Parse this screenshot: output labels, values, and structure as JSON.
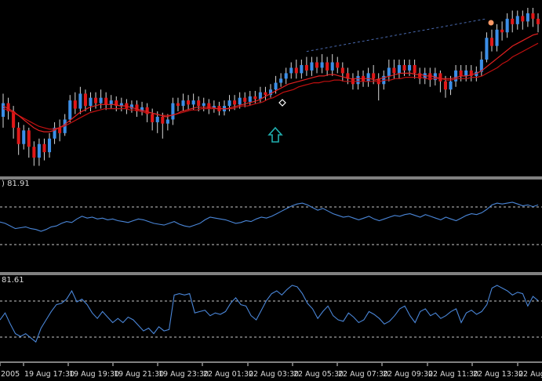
{
  "colors": {
    "background": "#000000",
    "bull_candle": "#3c8fe8",
    "bear_candle": "#e01818",
    "wick": "#d8d8d8",
    "ma_fast": "#e02020",
    "ma_slow": "#c01010",
    "indicator_line": "#4a86d8",
    "level_line": "#c8c8c8",
    "separator": "#ffffff",
    "arrow": "#20b0b0",
    "marker_up": "#ff9966",
    "marker_diamond": "#ffffff",
    "trendline": "#4a6ab0"
  },
  "panels": {
    "indicator1": {
      "label": ") 81.91"
    },
    "indicator2": {
      "label": "81.61"
    }
  },
  "chart_data": [
    {
      "type": "candlestick",
      "title": "",
      "legend": "none",
      "y_axis": "not shown",
      "series": [
        {
          "name": "",
          "values": []
        }
      ],
      "candles_rel": [
        {
          "o": 0.38,
          "c": 0.48,
          "h": 0.55,
          "l": 0.3
        },
        {
          "o": 0.48,
          "c": 0.42,
          "h": 0.52,
          "l": 0.36
        },
        {
          "o": 0.42,
          "c": 0.3,
          "h": 0.46,
          "l": 0.22
        },
        {
          "o": 0.3,
          "c": 0.18,
          "h": 0.34,
          "l": 0.1
        },
        {
          "o": 0.18,
          "c": 0.28,
          "h": 0.32,
          "l": 0.14
        },
        {
          "o": 0.28,
          "c": 0.16,
          "h": 0.3,
          "l": 0.08
        },
        {
          "o": 0.16,
          "c": 0.08,
          "h": 0.2,
          "l": 0.02
        },
        {
          "o": 0.08,
          "c": 0.18,
          "h": 0.22,
          "l": 0.02
        },
        {
          "o": 0.18,
          "c": 0.12,
          "h": 0.22,
          "l": 0.06
        },
        {
          "o": 0.12,
          "c": 0.22,
          "h": 0.26,
          "l": 0.08
        },
        {
          "o": 0.22,
          "c": 0.3,
          "h": 0.34,
          "l": 0.18
        },
        {
          "o": 0.3,
          "c": 0.26,
          "h": 0.36,
          "l": 0.2
        },
        {
          "o": 0.26,
          "c": 0.36,
          "h": 0.4,
          "l": 0.24
        },
        {
          "o": 0.36,
          "c": 0.5,
          "h": 0.54,
          "l": 0.34
        },
        {
          "o": 0.5,
          "c": 0.44,
          "h": 0.56,
          "l": 0.4
        },
        {
          "o": 0.44,
          "c": 0.55,
          "h": 0.6,
          "l": 0.4
        },
        {
          "o": 0.55,
          "c": 0.46,
          "h": 0.58,
          "l": 0.42
        },
        {
          "o": 0.46,
          "c": 0.52,
          "h": 0.56,
          "l": 0.42
        },
        {
          "o": 0.52,
          "c": 0.48,
          "h": 0.56,
          "l": 0.44
        },
        {
          "o": 0.48,
          "c": 0.52,
          "h": 0.58,
          "l": 0.44
        },
        {
          "o": 0.52,
          "c": 0.47,
          "h": 0.56,
          "l": 0.43
        },
        {
          "o": 0.47,
          "c": 0.5,
          "h": 0.54,
          "l": 0.44
        },
        {
          "o": 0.5,
          "c": 0.46,
          "h": 0.53,
          "l": 0.42
        },
        {
          "o": 0.46,
          "c": 0.48,
          "h": 0.52,
          "l": 0.42
        },
        {
          "o": 0.48,
          "c": 0.44,
          "h": 0.51,
          "l": 0.4
        },
        {
          "o": 0.44,
          "c": 0.47,
          "h": 0.5,
          "l": 0.41
        },
        {
          "o": 0.47,
          "c": 0.42,
          "h": 0.5,
          "l": 0.38
        },
        {
          "o": 0.42,
          "c": 0.45,
          "h": 0.49,
          "l": 0.39
        },
        {
          "o": 0.45,
          "c": 0.4,
          "h": 0.48,
          "l": 0.34
        },
        {
          "o": 0.4,
          "c": 0.34,
          "h": 0.44,
          "l": 0.28
        },
        {
          "o": 0.34,
          "c": 0.38,
          "h": 0.42,
          "l": 0.26
        },
        {
          "o": 0.38,
          "c": 0.33,
          "h": 0.41,
          "l": 0.22
        },
        {
          "o": 0.33,
          "c": 0.36,
          "h": 0.4,
          "l": 0.28
        },
        {
          "o": 0.36,
          "c": 0.48,
          "h": 0.52,
          "l": 0.32
        },
        {
          "o": 0.48,
          "c": 0.46,
          "h": 0.52,
          "l": 0.42
        },
        {
          "o": 0.46,
          "c": 0.5,
          "h": 0.55,
          "l": 0.42
        },
        {
          "o": 0.5,
          "c": 0.47,
          "h": 0.54,
          "l": 0.43
        },
        {
          "o": 0.47,
          "c": 0.5,
          "h": 0.55,
          "l": 0.43
        },
        {
          "o": 0.5,
          "c": 0.46,
          "h": 0.53,
          "l": 0.42
        },
        {
          "o": 0.46,
          "c": 0.48,
          "h": 0.52,
          "l": 0.42
        },
        {
          "o": 0.48,
          "c": 0.44,
          "h": 0.51,
          "l": 0.4
        },
        {
          "o": 0.44,
          "c": 0.46,
          "h": 0.5,
          "l": 0.41
        },
        {
          "o": 0.46,
          "c": 0.42,
          "h": 0.49,
          "l": 0.39
        },
        {
          "o": 0.42,
          "c": 0.46,
          "h": 0.5,
          "l": 0.39
        },
        {
          "o": 0.46,
          "c": 0.5,
          "h": 0.54,
          "l": 0.42
        },
        {
          "o": 0.5,
          "c": 0.47,
          "h": 0.54,
          "l": 0.43
        },
        {
          "o": 0.47,
          "c": 0.52,
          "h": 0.56,
          "l": 0.44
        },
        {
          "o": 0.52,
          "c": 0.49,
          "h": 0.56,
          "l": 0.45
        },
        {
          "o": 0.49,
          "c": 0.53,
          "h": 0.57,
          "l": 0.46
        },
        {
          "o": 0.53,
          "c": 0.51,
          "h": 0.57,
          "l": 0.48
        },
        {
          "o": 0.51,
          "c": 0.56,
          "h": 0.6,
          "l": 0.48
        },
        {
          "o": 0.56,
          "c": 0.54,
          "h": 0.6,
          "l": 0.5
        },
        {
          "o": 0.54,
          "c": 0.58,
          "h": 0.62,
          "l": 0.52
        },
        {
          "o": 0.58,
          "c": 0.63,
          "h": 0.68,
          "l": 0.55
        },
        {
          "o": 0.63,
          "c": 0.66,
          "h": 0.7,
          "l": 0.6
        },
        {
          "o": 0.66,
          "c": 0.7,
          "h": 0.74,
          "l": 0.62
        },
        {
          "o": 0.7,
          "c": 0.74,
          "h": 0.78,
          "l": 0.66
        },
        {
          "o": 0.74,
          "c": 0.7,
          "h": 0.8,
          "l": 0.66
        },
        {
          "o": 0.7,
          "c": 0.76,
          "h": 0.8,
          "l": 0.66
        },
        {
          "o": 0.76,
          "c": 0.72,
          "h": 0.82,
          "l": 0.68
        },
        {
          "o": 0.72,
          "c": 0.78,
          "h": 0.82,
          "l": 0.68
        },
        {
          "o": 0.78,
          "c": 0.74,
          "h": 0.82,
          "l": 0.7
        },
        {
          "o": 0.74,
          "c": 0.78,
          "h": 0.84,
          "l": 0.7
        },
        {
          "o": 0.78,
          "c": 0.72,
          "h": 0.82,
          "l": 0.68
        },
        {
          "o": 0.72,
          "c": 0.78,
          "h": 0.84,
          "l": 0.68
        },
        {
          "o": 0.78,
          "c": 0.74,
          "h": 0.82,
          "l": 0.7
        },
        {
          "o": 0.74,
          "c": 0.7,
          "h": 0.78,
          "l": 0.64
        },
        {
          "o": 0.7,
          "c": 0.66,
          "h": 0.74,
          "l": 0.62
        },
        {
          "o": 0.66,
          "c": 0.62,
          "h": 0.7,
          "l": 0.58
        },
        {
          "o": 0.62,
          "c": 0.68,
          "h": 0.72,
          "l": 0.58
        },
        {
          "o": 0.68,
          "c": 0.64,
          "h": 0.72,
          "l": 0.6
        },
        {
          "o": 0.64,
          "c": 0.7,
          "h": 0.74,
          "l": 0.6
        },
        {
          "o": 0.7,
          "c": 0.66,
          "h": 0.76,
          "l": 0.62
        },
        {
          "o": 0.66,
          "c": 0.62,
          "h": 0.7,
          "l": 0.5
        },
        {
          "o": 0.62,
          "c": 0.68,
          "h": 0.72,
          "l": 0.58
        },
        {
          "o": 0.68,
          "c": 0.74,
          "h": 0.8,
          "l": 0.64
        },
        {
          "o": 0.74,
          "c": 0.7,
          "h": 0.8,
          "l": 0.66
        },
        {
          "o": 0.7,
          "c": 0.76,
          "h": 0.8,
          "l": 0.66
        },
        {
          "o": 0.76,
          "c": 0.72,
          "h": 0.8,
          "l": 0.68
        },
        {
          "o": 0.72,
          "c": 0.76,
          "h": 0.8,
          "l": 0.68
        },
        {
          "o": 0.76,
          "c": 0.7,
          "h": 0.8,
          "l": 0.66
        },
        {
          "o": 0.7,
          "c": 0.66,
          "h": 0.74,
          "l": 0.62
        },
        {
          "o": 0.66,
          "c": 0.7,
          "h": 0.74,
          "l": 0.62
        },
        {
          "o": 0.7,
          "c": 0.65,
          "h": 0.74,
          "l": 0.6
        },
        {
          "o": 0.65,
          "c": 0.7,
          "h": 0.74,
          "l": 0.61
        },
        {
          "o": 0.7,
          "c": 0.64,
          "h": 0.72,
          "l": 0.56
        },
        {
          "o": 0.64,
          "c": 0.58,
          "h": 0.68,
          "l": 0.52
        },
        {
          "o": 0.58,
          "c": 0.64,
          "h": 0.68,
          "l": 0.54
        },
        {
          "o": 0.64,
          "c": 0.72,
          "h": 0.76,
          "l": 0.6
        },
        {
          "o": 0.72,
          "c": 0.68,
          "h": 0.76,
          "l": 0.64
        },
        {
          "o": 0.68,
          "c": 0.72,
          "h": 0.76,
          "l": 0.64
        },
        {
          "o": 0.72,
          "c": 0.68,
          "h": 0.76,
          "l": 0.64
        },
        {
          "o": 0.68,
          "c": 0.71,
          "h": 0.75,
          "l": 0.64
        },
        {
          "o": 0.71,
          "c": 0.8,
          "h": 0.86,
          "l": 0.68
        },
        {
          "o": 0.8,
          "c": 0.96,
          "h": 1.0,
          "l": 0.78
        },
        {
          "o": 0.96,
          "c": 0.9,
          "h": 1.02,
          "l": 0.86
        },
        {
          "o": 0.9,
          "c": 1.02,
          "h": 1.06,
          "l": 0.86
        },
        {
          "o": 1.02,
          "c": 1.0,
          "h": 1.08,
          "l": 0.94
        },
        {
          "o": 1.0,
          "c": 1.1,
          "h": 1.14,
          "l": 0.96
        },
        {
          "o": 1.1,
          "c": 1.06,
          "h": 1.16,
          "l": 1.0
        },
        {
          "o": 1.06,
          "c": 1.12,
          "h": 1.16,
          "l": 1.02
        },
        {
          "o": 1.12,
          "c": 1.08,
          "h": 1.16,
          "l": 1.02
        },
        {
          "o": 1.08,
          "c": 1.14,
          "h": 1.18,
          "l": 1.04
        },
        {
          "o": 1.14,
          "c": 1.1,
          "h": 1.18,
          "l": 1.04
        },
        {
          "o": 1.1,
          "c": 1.06,
          "h": 1.14,
          "l": 1.0
        }
      ],
      "ma_fast_rel": [
        0.46,
        0.44,
        0.42,
        0.39,
        0.36,
        0.33,
        0.3,
        0.28,
        0.27,
        0.27,
        0.28,
        0.3,
        0.32,
        0.35,
        0.38,
        0.41,
        0.43,
        0.45,
        0.46,
        0.47,
        0.47,
        0.47,
        0.47,
        0.46,
        0.46,
        0.45,
        0.44,
        0.43,
        0.42,
        0.41,
        0.4,
        0.39,
        0.38,
        0.39,
        0.4,
        0.42,
        0.43,
        0.44,
        0.45,
        0.45,
        0.45,
        0.45,
        0.44,
        0.44,
        0.44,
        0.45,
        0.46,
        0.47,
        0.48,
        0.49,
        0.5,
        0.52,
        0.54,
        0.56,
        0.58,
        0.6,
        0.62,
        0.63,
        0.64,
        0.65,
        0.66,
        0.67,
        0.68,
        0.68,
        0.69,
        0.69,
        0.68,
        0.67,
        0.66,
        0.66,
        0.66,
        0.66,
        0.66,
        0.65,
        0.66,
        0.67,
        0.68,
        0.69,
        0.7,
        0.7,
        0.7,
        0.69,
        0.69,
        0.68,
        0.68,
        0.67,
        0.66,
        0.66,
        0.66,
        0.67,
        0.68,
        0.68,
        0.69,
        0.7,
        0.72,
        0.75,
        0.78,
        0.81,
        0.84,
        0.87,
        0.9,
        0.92,
        0.94,
        0.96,
        0.98,
        0.99
      ],
      "ma_slow_rel": [
        0.44,
        0.43,
        0.41,
        0.39,
        0.37,
        0.35,
        0.33,
        0.31,
        0.3,
        0.29,
        0.29,
        0.3,
        0.31,
        0.33,
        0.35,
        0.37,
        0.39,
        0.41,
        0.42,
        0.43,
        0.44,
        0.44,
        0.44,
        0.44,
        0.44,
        0.43,
        0.43,
        0.42,
        0.41,
        0.41,
        0.4,
        0.39,
        0.39,
        0.39,
        0.4,
        0.41,
        0.42,
        0.43,
        0.43,
        0.44,
        0.44,
        0.44,
        0.44,
        0.44,
        0.44,
        0.44,
        0.45,
        0.46,
        0.46,
        0.47,
        0.48,
        0.49,
        0.51,
        0.52,
        0.54,
        0.56,
        0.57,
        0.58,
        0.6,
        0.61,
        0.62,
        0.63,
        0.63,
        0.64,
        0.64,
        0.65,
        0.65,
        0.64,
        0.64,
        0.64,
        0.64,
        0.64,
        0.64,
        0.64,
        0.64,
        0.65,
        0.65,
        0.66,
        0.66,
        0.67,
        0.67,
        0.67,
        0.67,
        0.66,
        0.66,
        0.66,
        0.66,
        0.65,
        0.65,
        0.66,
        0.66,
        0.66,
        0.67,
        0.67,
        0.68,
        0.7,
        0.72,
        0.74,
        0.77,
        0.79,
        0.82,
        0.84,
        0.86,
        0.88,
        0.9,
        0.92
      ]
    },
    {
      "type": "line",
      "name": "indicator1",
      "label": ") 81.91",
      "level_lines": [
        "upper",
        "lower"
      ],
      "values_rel": [
        0.55,
        0.52,
        0.46,
        0.4,
        0.42,
        0.44,
        0.4,
        0.38,
        0.34,
        0.38,
        0.44,
        0.46,
        0.52,
        0.56,
        0.54,
        0.62,
        0.68,
        0.64,
        0.66,
        0.62,
        0.64,
        0.6,
        0.62,
        0.58,
        0.56,
        0.54,
        0.58,
        0.62,
        0.6,
        0.56,
        0.52,
        0.5,
        0.48,
        0.52,
        0.56,
        0.5,
        0.46,
        0.44,
        0.48,
        0.52,
        0.6,
        0.66,
        0.64,
        0.62,
        0.6,
        0.56,
        0.52,
        0.54,
        0.58,
        0.56,
        0.62,
        0.66,
        0.64,
        0.68,
        0.74,
        0.8,
        0.86,
        0.92,
        0.96,
        0.98,
        0.94,
        0.88,
        0.82,
        0.86,
        0.8,
        0.74,
        0.7,
        0.66,
        0.68,
        0.64,
        0.6,
        0.64,
        0.68,
        0.62,
        0.58,
        0.62,
        0.66,
        0.7,
        0.68,
        0.72,
        0.74,
        0.7,
        0.66,
        0.72,
        0.68,
        0.64,
        0.6,
        0.66,
        0.62,
        0.58,
        0.64,
        0.7,
        0.74,
        0.72,
        0.76,
        0.84,
        0.94,
        0.98,
        0.96,
        0.98,
        1.0,
        0.96,
        0.92,
        0.94,
        0.9,
        0.94
      ]
    },
    {
      "type": "line",
      "name": "indicator2",
      "label": "81.61",
      "level_lines": [
        "upper",
        "lower"
      ],
      "values_rel": [
        0.5,
        0.6,
        0.44,
        0.3,
        0.26,
        0.3,
        0.24,
        0.18,
        0.38,
        0.5,
        0.62,
        0.72,
        0.74,
        0.8,
        0.92,
        0.76,
        0.8,
        0.72,
        0.6,
        0.52,
        0.62,
        0.54,
        0.46,
        0.52,
        0.46,
        0.54,
        0.5,
        0.42,
        0.34,
        0.38,
        0.3,
        0.4,
        0.34,
        0.36,
        0.86,
        0.88,
        0.86,
        0.88,
        0.6,
        0.62,
        0.64,
        0.56,
        0.6,
        0.58,
        0.62,
        0.74,
        0.82,
        0.72,
        0.7,
        0.56,
        0.5,
        0.64,
        0.78,
        0.88,
        0.92,
        0.86,
        0.94,
        1.0,
        0.98,
        0.88,
        0.74,
        0.66,
        0.52,
        0.62,
        0.7,
        0.56,
        0.5,
        0.48,
        0.6,
        0.54,
        0.46,
        0.5,
        0.62,
        0.58,
        0.52,
        0.44,
        0.48,
        0.56,
        0.66,
        0.7,
        0.56,
        0.46,
        0.62,
        0.66,
        0.56,
        0.6,
        0.52,
        0.56,
        0.62,
        0.66,
        0.46,
        0.6,
        0.64,
        0.58,
        0.62,
        0.72,
        0.96,
        1.0,
        0.96,
        0.92,
        0.86,
        0.9,
        0.88,
        0.7,
        0.84,
        0.78
      ]
    }
  ],
  "time_axis": {
    "labels": [
      "2005",
      "19 Aug 17:30",
      "19 Aug 19:30",
      "19 Aug 21:30",
      "19 Aug 23:30",
      "22 Aug 01:30",
      "22 Aug 03:30",
      "22 Aug 05:30",
      "22 Aug 07:30",
      "22 Aug 09:30",
      "22 Aug 11:30",
      "22 Aug 13:30",
      "22 Aug"
    ]
  }
}
